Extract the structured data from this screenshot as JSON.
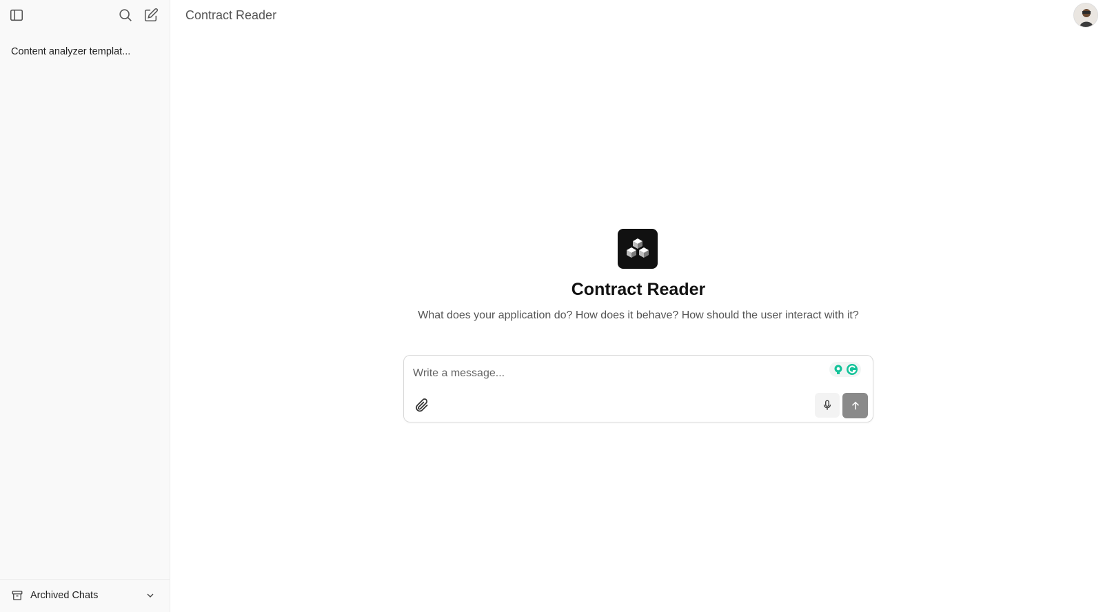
{
  "sidebar": {
    "toggle_icon": "sidebar-toggle-icon",
    "search_icon": "search-icon",
    "new_chat_icon": "new-chat-icon",
    "chats": [
      {
        "label": "Content analyzer templat..."
      }
    ],
    "archived": {
      "label": "Archived Chats",
      "icon": "archive-icon",
      "chevron": "chevron-down-icon"
    }
  },
  "header": {
    "title": "Contract Reader"
  },
  "main": {
    "app_title": "Contract Reader",
    "app_description": "What does your application do? How does it behave? How should the user interact with it?",
    "composer": {
      "placeholder": "Write a message...",
      "attach_icon": "paperclip-icon",
      "mic_icon": "microphone-icon",
      "send_icon": "arrow-up-icon"
    }
  },
  "colors": {
    "sidebar_bg": "#f9f9f9",
    "logo_bg": "#111111",
    "send_button": "#8a8a8a",
    "grammarly_green": "#15c39a"
  }
}
